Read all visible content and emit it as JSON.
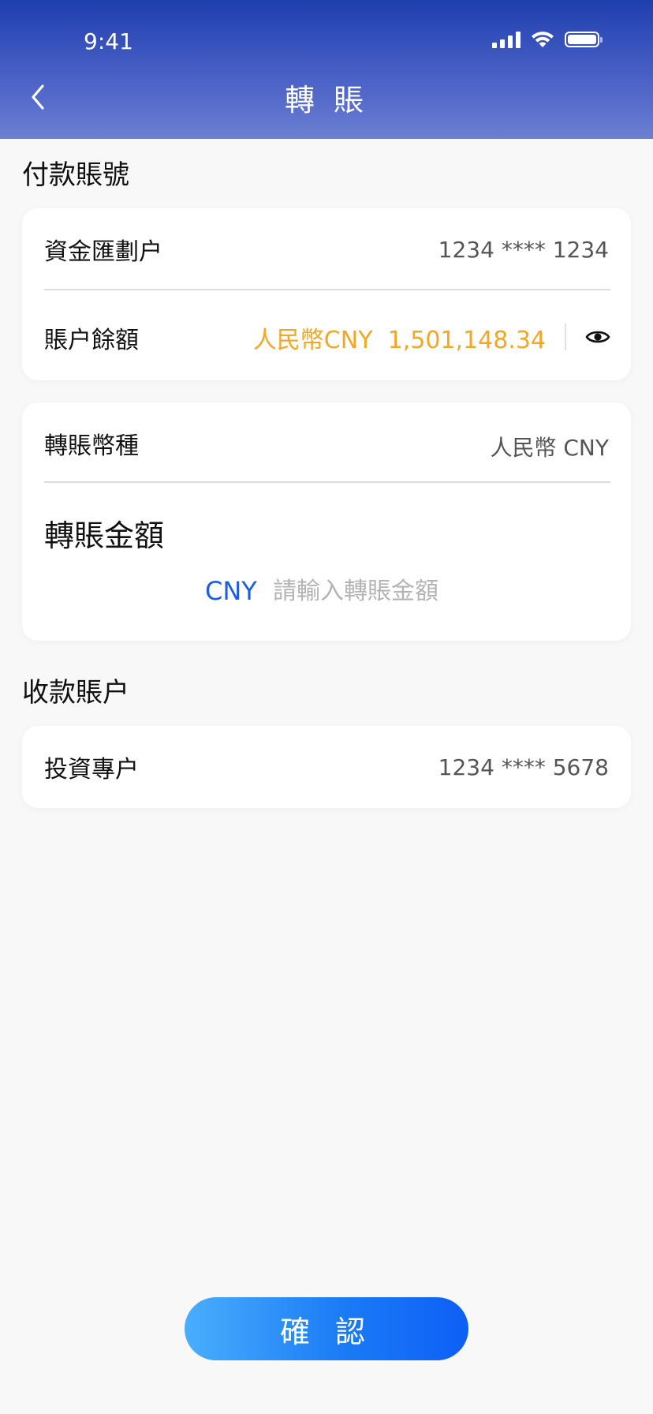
{
  "status_bar": {
    "time": "9:41"
  },
  "nav": {
    "title": "轉 賬",
    "back_icon": "chevron-left-icon"
  },
  "payment_section": {
    "title": "付款賬號",
    "account_label": "資金匯劃户",
    "account_number": "1234 **** 1234",
    "balance_label": "賬户餘額",
    "balance_currency": "人民幣CNY",
    "balance_amount": "1,501,148.34",
    "balance_color": "#f5a623",
    "visibility_icon": "eye-icon"
  },
  "transfer_section": {
    "currency_label": "轉賬幣種",
    "currency_value": "人民幣 CNY",
    "amount_title": "轉賬金額",
    "amount_currency": "CNY",
    "amount_value": "",
    "amount_placeholder": "請輸入轉賬金額",
    "accent_color": "#1a5fe0"
  },
  "receiving_section": {
    "title": "收款賬户",
    "account_label": "投資專户",
    "account_number": "1234 **** 5678"
  },
  "confirm_button": {
    "label": "確 認"
  }
}
